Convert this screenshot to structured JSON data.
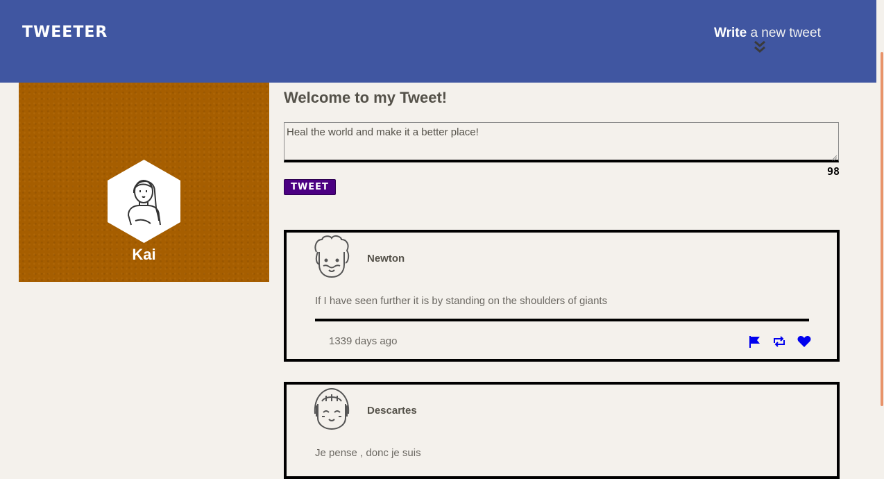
{
  "nav": {
    "brand": "TWEETER",
    "write_bold": "Write",
    "write_rest": " a new tweet"
  },
  "profile": {
    "name": "Kai"
  },
  "composer": {
    "heading": "Welcome to my Tweet!",
    "input_value": "Heal the world and make it a better place!",
    "counter": "98",
    "submit_label": "TWEET"
  },
  "tweets": [
    {
      "author": "Newton",
      "content": "If I have seen further it is by standing on the shoulders of giants",
      "timestamp": "1339 days ago"
    },
    {
      "author": "Descartes",
      "content": "Je pense , donc je suis"
    }
  ],
  "colors": {
    "nav_bg": "#4056a1",
    "profile_bg": "#a65e00",
    "button_bg": "#4b0082",
    "action_icons": "#0000ee",
    "page_bg": "#f4f1ec"
  }
}
